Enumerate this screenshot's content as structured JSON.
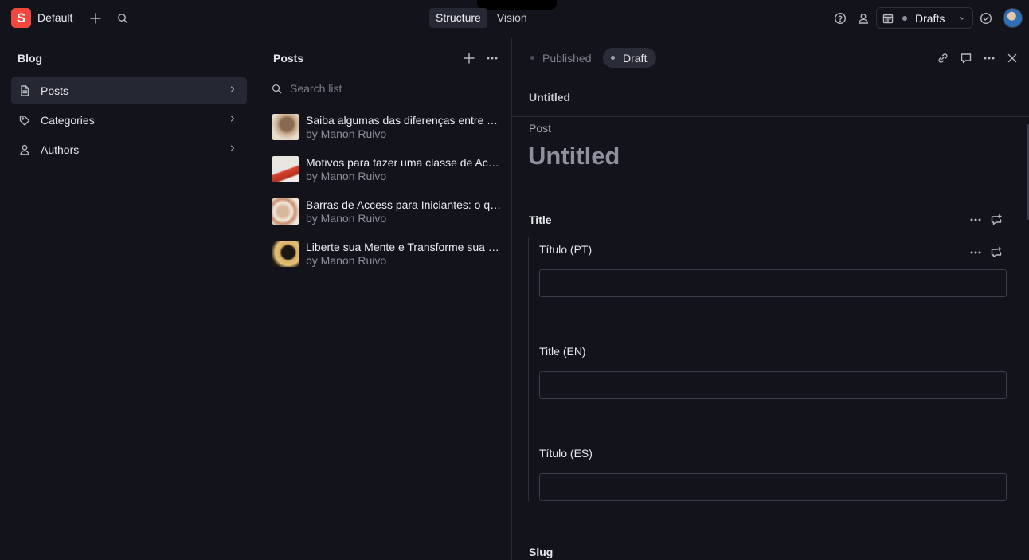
{
  "topbar": {
    "logo_letter": "S",
    "workspace": "Default",
    "tools": [
      {
        "label": "Structure",
        "active": true
      },
      {
        "label": "Vision",
        "active": false
      }
    ],
    "perspective_label": "Drafts",
    "colors": {
      "logo": "#f0483e",
      "background": "#13141b"
    },
    "icons": [
      "plus-icon",
      "search-icon",
      "help-icon",
      "users-icon",
      "calendar-icon",
      "chevron-down-icon",
      "check-circle-icon"
    ]
  },
  "blog_pane": {
    "title": "Blog",
    "items": [
      {
        "label": "Posts",
        "icon": "document-icon",
        "active": true
      },
      {
        "label": "Categories",
        "icon": "tag-icon",
        "active": false
      },
      {
        "label": "Authors",
        "icon": "user-icon",
        "active": false
      }
    ]
  },
  "posts_pane": {
    "title": "Posts",
    "search_placeholder": "Search list",
    "posts": [
      {
        "title": "Saiba algumas das diferenças entre Terapia e Coaching",
        "subtitle": "by Manon Ruivo"
      },
      {
        "title": "Motivos para fazer uma classe de Access Bars",
        "subtitle": "by Manon Ruivo"
      },
      {
        "title": "Barras de Access para Iniciantes: o que esperar",
        "subtitle": "by Manon Ruivo"
      },
      {
        "title": "Liberte sua Mente e Transforme sua Vida",
        "subtitle": "by Manon Ruivo"
      }
    ]
  },
  "document": {
    "status": [
      {
        "label": "Published",
        "active": false
      },
      {
        "label": "Draft",
        "active": true
      }
    ],
    "header_title": "Untitled",
    "type_label": "Post",
    "big_title": "Untitled",
    "fields": {
      "title_group": "Title",
      "title_pt": {
        "label": "Título (PT)",
        "value": ""
      },
      "title_en": {
        "label": "Title (EN)",
        "value": ""
      },
      "title_es": {
        "label": "Título (ES)",
        "value": ""
      },
      "slug": "Slug"
    }
  }
}
